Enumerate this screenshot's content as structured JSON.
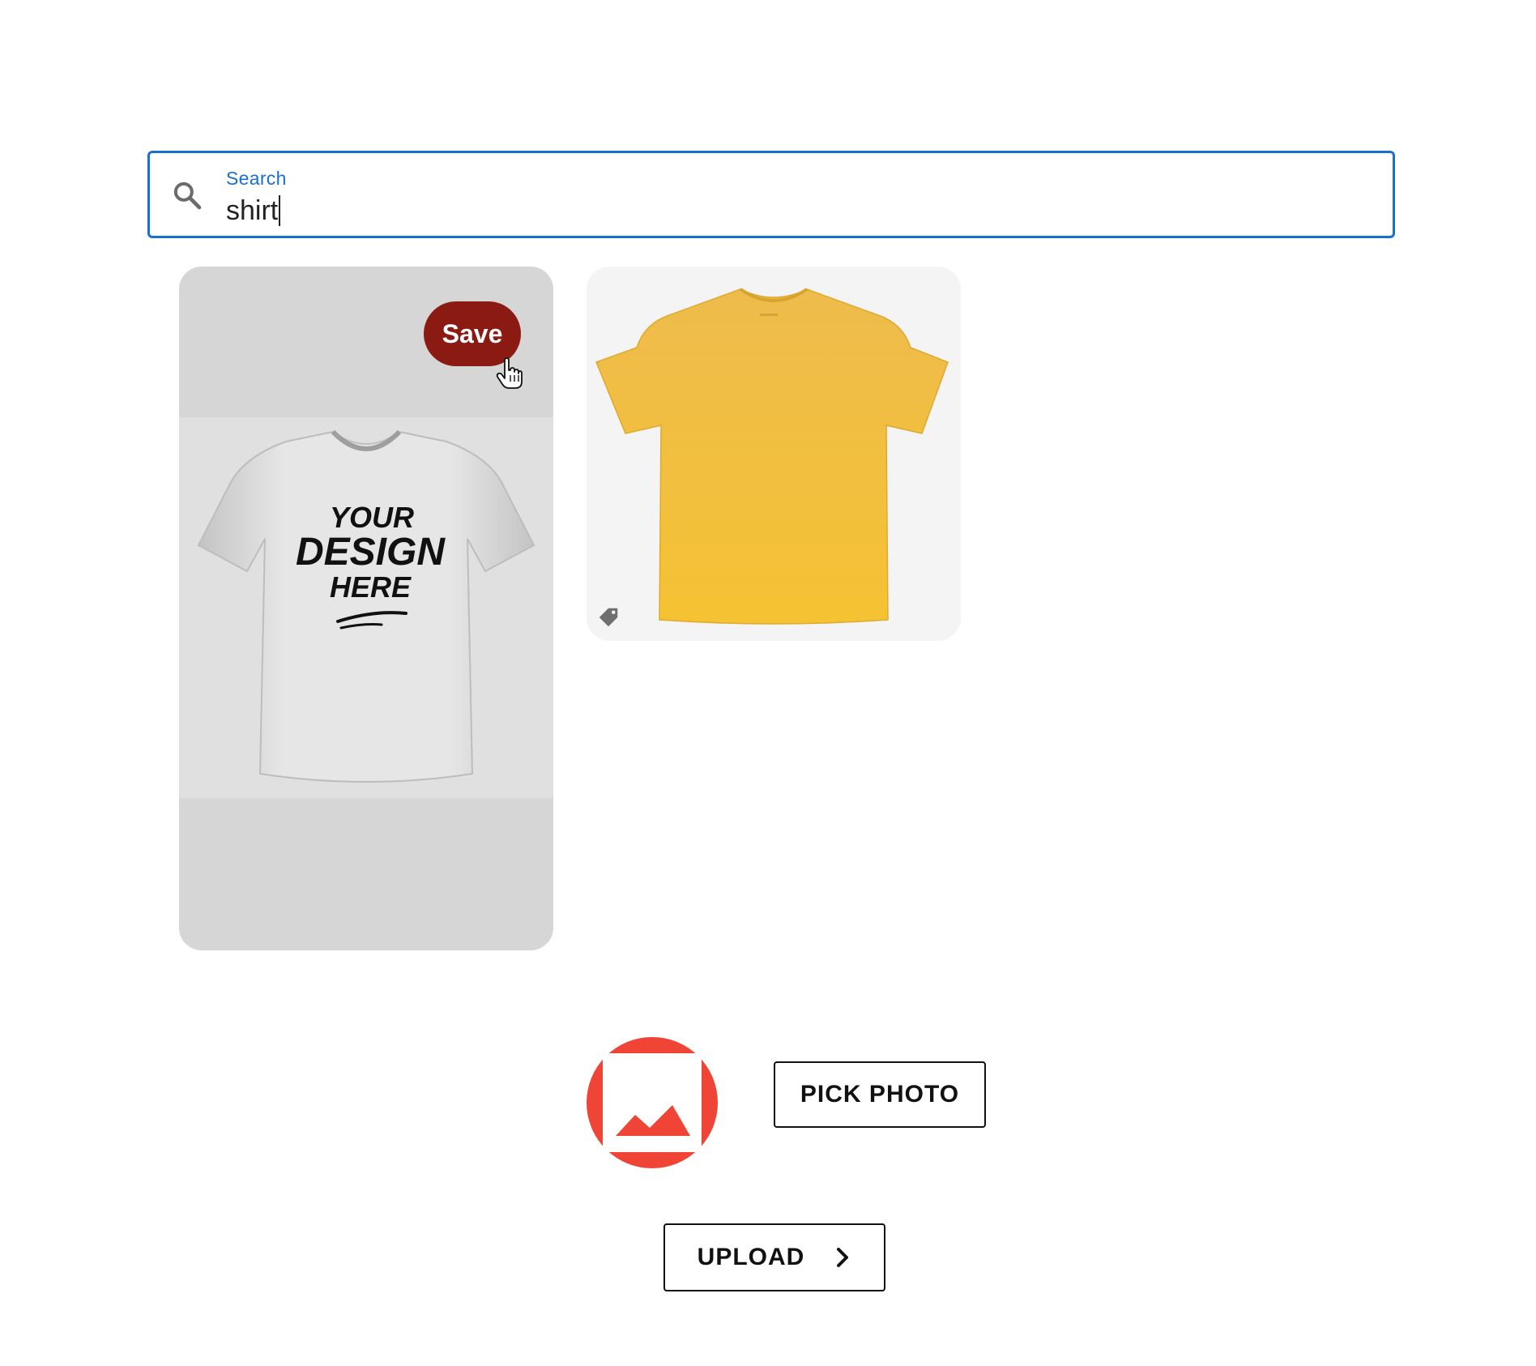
{
  "search": {
    "label": "Search",
    "value": "shirt",
    "icon": "search-icon"
  },
  "results": [
    {
      "save_label": "Save",
      "image_text": [
        "YOUR",
        "DESIGN",
        "HERE"
      ],
      "image_description_icon": "white-tshirt-mockup"
    },
    {
      "icon": "price-tag-icon",
      "image_description_icon": "yellow-tshirt"
    }
  ],
  "picker": {
    "photo_icon": "image-placeholder-icon",
    "pick_label": "PICK PHOTO",
    "upload_label": "UPLOAD",
    "upload_icon": "chevron-right-icon"
  },
  "colors": {
    "accent": "#1a6fcf",
    "save_button": "#8b1a12",
    "photo_avatar": "#f04436",
    "shirt_yellow": "#f3bb3a"
  }
}
